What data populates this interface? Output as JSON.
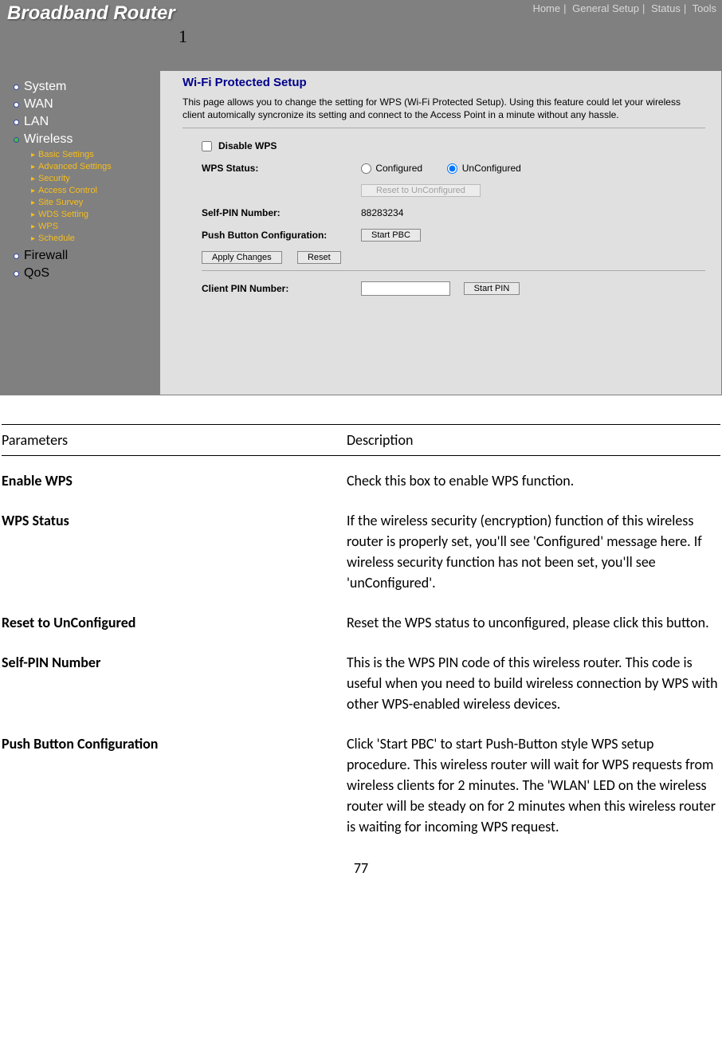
{
  "router": {
    "title": "Broadband Router",
    "topNav": [
      "Home",
      "General Setup",
      "Status",
      "Tools"
    ],
    "cornerNumber": "1",
    "nav": {
      "main": [
        {
          "label": "System",
          "active": false,
          "dim": false
        },
        {
          "label": "WAN",
          "active": false,
          "dim": false
        },
        {
          "label": "LAN",
          "active": false,
          "dim": false
        },
        {
          "label": "Wireless",
          "active": true,
          "dim": false
        },
        {
          "label": "Firewall",
          "active": false,
          "dim": true
        },
        {
          "label": "QoS",
          "active": false,
          "dim": true
        }
      ],
      "wirelessSub": [
        "Basic Settings",
        "Advanced Settings",
        "Security",
        "Access Control",
        "Site Survey",
        "WDS Setting",
        "WPS",
        "Schedule"
      ]
    },
    "page": {
      "heading": "Wi-Fi Protected Setup",
      "desc": "This page allows you to change the setting for WPS (Wi-Fi Protected Setup). Using this feature could let your wireless client automically syncronize its setting and connect to the Access Point in a minute without any hassle.",
      "disableLabel": "Disable WPS",
      "wpsStatusLabel": "WPS Status:",
      "radioConfigured": "Configured",
      "radioUnconfigured": "UnConfigured",
      "resetBtn": "Reset to UnConfigured",
      "selfPinLabel": "Self-PIN Number:",
      "selfPinValue": "88283234",
      "pbcLabel": "Push Button Configuration:",
      "startPbcBtn": "Start PBC",
      "applyBtn": "Apply Changes",
      "resetFormBtn": "Reset",
      "clientPinLabel": "Client PIN Number:",
      "clientPinValue": "",
      "startPinBtn": "Start PIN"
    }
  },
  "doc": {
    "header": {
      "param": "Parameters",
      "desc": "Description"
    },
    "rows": [
      {
        "param": "Enable  WPS",
        "desc": "Check this box to enable WPS function."
      },
      {
        "param": "WPS Status",
        "desc": "If the wireless security (encryption) function of this wireless router is properly set, you'll see 'Configured' message here. If wireless security function has not been set, you'll see 'unConfigured'."
      },
      {
        "param": "Reset to UnConfigured",
        "desc": "Reset the WPS status to unconfigured, please click this button."
      },
      {
        "param": "Self-PIN Number",
        "desc": "This is the WPS PIN code of this wireless router. This code is useful when you need to build wireless connection by WPS with other WPS-enabled wireless devices."
      },
      {
        "param": "Push Button Configuration",
        "desc": "Click 'Start PBC' to start Push-Button style WPS setup procedure. This wireless router will wait for WPS requests from wireless clients for 2 minutes. The 'WLAN' LED on the wireless router will be steady on for 2 minutes when this wireless router is waiting for incoming WPS request."
      }
    ],
    "pageNumber": "77"
  }
}
